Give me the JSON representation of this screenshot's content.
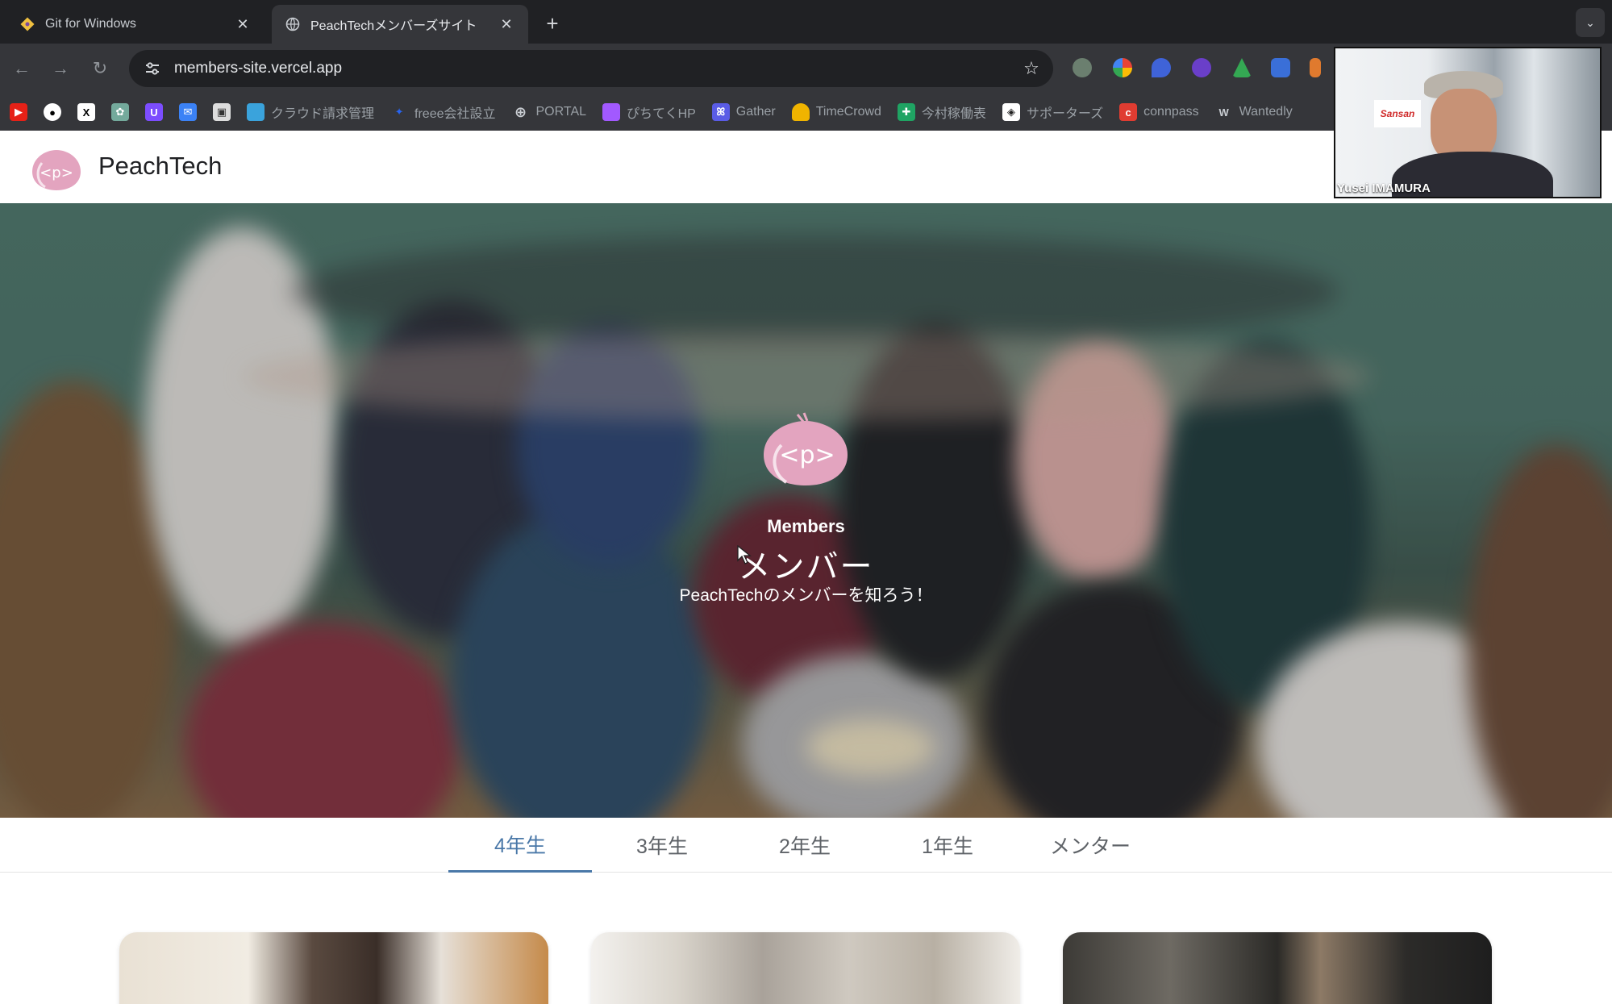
{
  "browser": {
    "tabs": [
      {
        "title": "Git for Windows",
        "icon": "git-icon",
        "active": false
      },
      {
        "title": "PeachTechメンバーズサイト",
        "icon": "globe-icon",
        "active": true
      }
    ],
    "new_tab_label": "+",
    "close_glyph": "✕",
    "address": "members-site.vercel.app",
    "bookmarks": [
      {
        "label": "",
        "icon": "youtube-icon",
        "color": "#e62117"
      },
      {
        "label": "",
        "icon": "github-icon",
        "color": "#ffffff"
      },
      {
        "label": "",
        "icon": "x-icon",
        "color": "#000000"
      },
      {
        "label": "",
        "icon": "chatgpt-icon",
        "color": "#74aa9c"
      },
      {
        "label": "",
        "icon": "extension-purple-icon",
        "color": "#7c4dff"
      },
      {
        "label": "",
        "icon": "mail-icon",
        "color": "#3b82f6"
      },
      {
        "label": "",
        "icon": "image-icon",
        "color": "#bbbbbb"
      },
      {
        "label": "クラウド請求管理",
        "icon": "invoice-icon",
        "color": "#3aa3dc"
      },
      {
        "label": "freee会社設立",
        "icon": "freee-icon",
        "color": "#2864f0"
      },
      {
        "label": "PORTAL",
        "icon": "globe-icon",
        "color": "#9aa0a6"
      },
      {
        "label": "ぴちてくHP",
        "icon": "figma-icon",
        "color": "#a259ff"
      },
      {
        "label": "Gather",
        "icon": "gather-icon",
        "color": "#5a5ce6"
      },
      {
        "label": "TimeCrowd",
        "icon": "timecrowd-icon",
        "color": "#f0b400"
      },
      {
        "label": "今村稼働表",
        "icon": "sheets-icon",
        "color": "#1fa463"
      },
      {
        "label": "サポーターズ",
        "icon": "supporters-icon",
        "color": "#333333"
      },
      {
        "label": "connpass",
        "icon": "connpass-icon",
        "color": "#e03c31"
      },
      {
        "label": "Wantedly",
        "icon": "wantedly-icon",
        "color": "#6c8fa6"
      }
    ]
  },
  "site": {
    "name": "PeachTech",
    "logo_text": "<p>"
  },
  "hero": {
    "eyebrow": "Members",
    "title": "メンバー",
    "subtitle": "PeachTechのメンバーを知ろう！"
  },
  "grade_tabs": [
    {
      "label": "4年生",
      "active": true
    },
    {
      "label": "3年生",
      "active": false
    },
    {
      "label": "2年生",
      "active": false
    },
    {
      "label": "1年生",
      "active": false
    },
    {
      "label": "メンター",
      "active": false
    }
  ],
  "video_call": {
    "participant": "Yusei IMAMURA",
    "sign_text": "Sansan"
  },
  "colors": {
    "accent_tab": "#4a78a8",
    "peach": "#e3a4bf"
  }
}
